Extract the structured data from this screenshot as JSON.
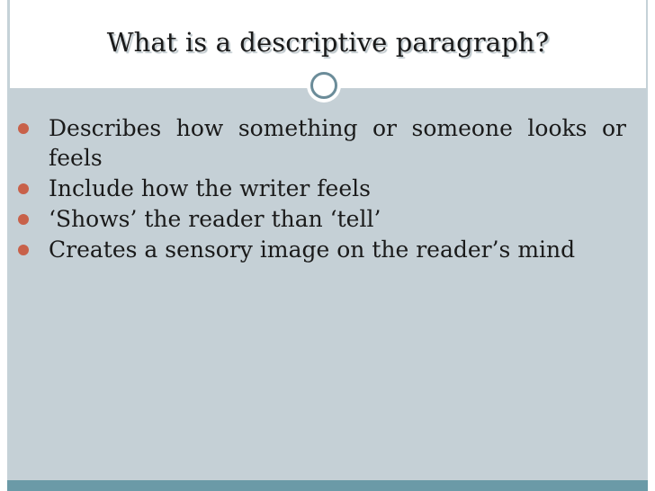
{
  "slide": {
    "title": "What is a descriptive paragraph?",
    "bullets": [
      "Describes how something or someone looks or feels",
      "Include how the writer feels",
      "‘Shows’ the reader than ‘tell’",
      "Creates a sensory image on the reader’s mind"
    ]
  },
  "colors": {
    "content_background": "#c5d0d6",
    "bullet_marker": "#c8614a",
    "accent_bar": "#6b9aa7"
  },
  "icons": {
    "divider_ornament": "circle-ornament-icon",
    "bullet_marker": "bullet-dot-icon"
  }
}
